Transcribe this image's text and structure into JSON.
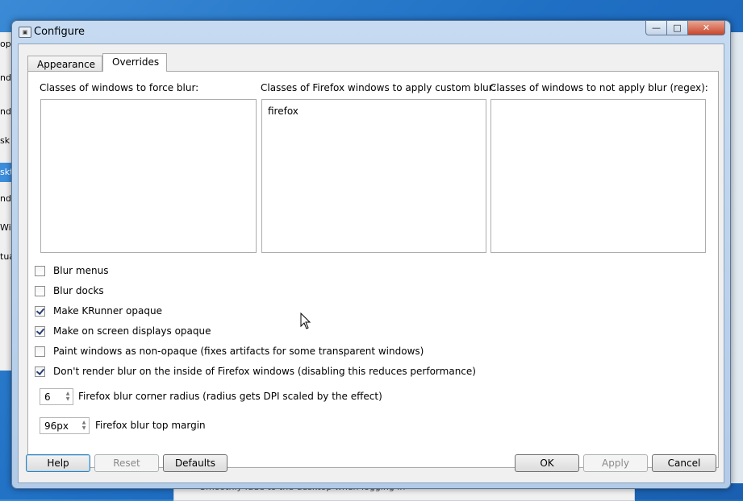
{
  "background": {
    "left_window_items": [
      "op",
      "nd",
      "ndo",
      "sk S",
      "skt",
      "ndo",
      "Win",
      "tua"
    ],
    "left_window_selected_index": 4,
    "bottom_text": "Smoothly fade to the desktop when logging in"
  },
  "window": {
    "title": "Configure",
    "icon": "configure-app-icon",
    "controls": {
      "minimize": "—",
      "maximize": "□",
      "close": "✕"
    }
  },
  "tabs": [
    {
      "label": "Appearance",
      "selected": false
    },
    {
      "label": "Overrides",
      "selected": true
    }
  ],
  "columns": [
    {
      "label": "Classes of windows to force blur:",
      "items": []
    },
    {
      "label": "Classes of Firefox windows to apply custom blur:",
      "items": [
        "firefox"
      ]
    },
    {
      "label": "Classes of windows to not apply blur (regex):",
      "items": []
    }
  ],
  "checkboxes": [
    {
      "label": "Blur menus",
      "checked": false
    },
    {
      "label": "Blur docks",
      "checked": false
    },
    {
      "label": "Make KRunner opaque",
      "checked": true
    },
    {
      "label": "Make on screen displays opaque",
      "checked": true
    },
    {
      "label": "Paint windows as non-opaque (fixes artifacts for some transparent windows)",
      "checked": false
    },
    {
      "label": "Don't render blur on the inside of Firefox windows (disabling this reduces performance)",
      "checked": true
    }
  ],
  "spinners": [
    {
      "value": "6",
      "label": "Firefox blur corner radius (radius gets DPI scaled by the effect)"
    },
    {
      "value": "96px",
      "label": "Firefox blur top margin"
    }
  ],
  "buttons": {
    "help": "Help",
    "reset": "Reset",
    "defaults": "Defaults",
    "ok": "OK",
    "apply": "Apply",
    "cancel": "Cancel"
  },
  "colors": {
    "desktop": "#1f6fc4",
    "titlebar": "#b9d1ea",
    "close_button": "#c9452b",
    "check": "#273f74"
  }
}
